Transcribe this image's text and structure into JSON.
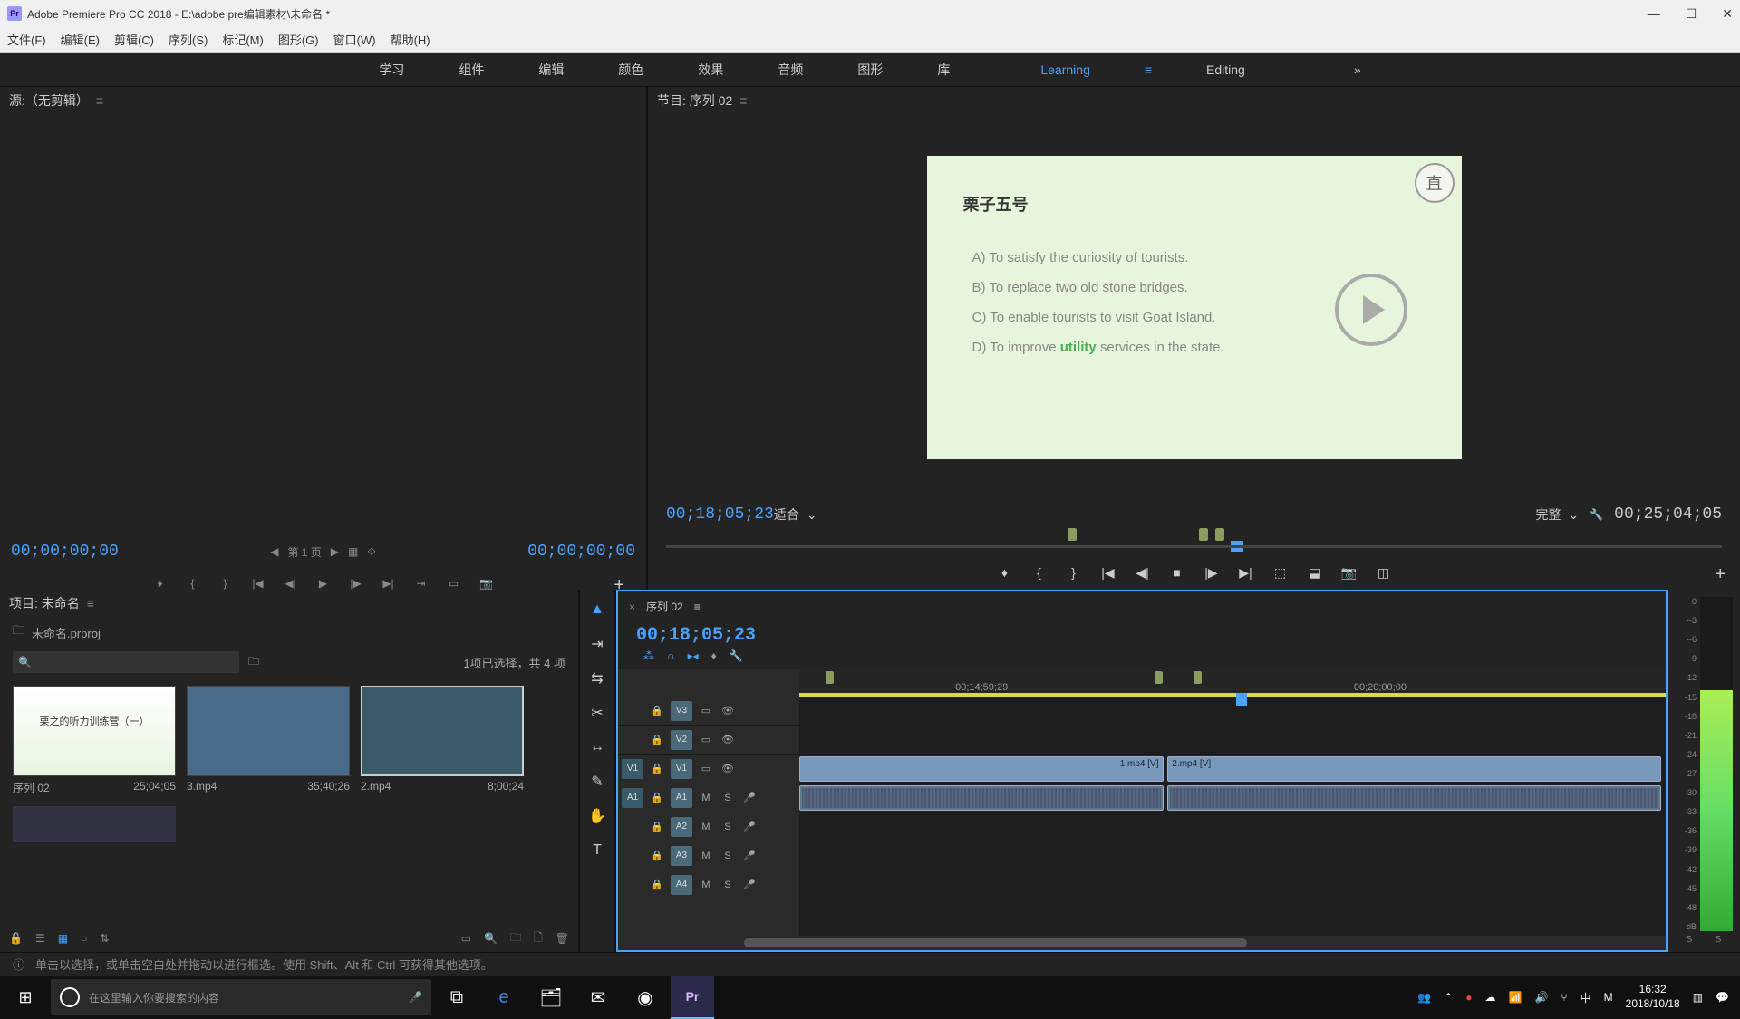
{
  "app": {
    "icon_label": "Pr",
    "title": "Adobe Premiere Pro CC 2018 - E:\\adobe pre编辑素材\\未命名 *"
  },
  "menubar": [
    "文件(F)",
    "编辑(E)",
    "剪辑(C)",
    "序列(S)",
    "标记(M)",
    "图形(G)",
    "窗口(W)",
    "帮助(H)"
  ],
  "workspaces": {
    "tabs": [
      "学习",
      "组件",
      "编辑",
      "颜色",
      "效果",
      "音频",
      "图形",
      "库"
    ],
    "learning": "Learning",
    "editing": "Editing"
  },
  "source_panel": {
    "title": "源:（无剪辑）",
    "timecode_left": "00;00;00;00",
    "page_nav": "第 1 页",
    "timecode_right": "00;00;00;00"
  },
  "program_panel": {
    "title": "节目: 序列 02",
    "timecode_left": "00;18;05;23",
    "fit_label": "适合",
    "quality_label": "完整",
    "timecode_right": "00;25;04;05",
    "video": {
      "heading": "栗子五号",
      "badge": "直",
      "opt_a": "A) To satisfy the curiosity of tourists.",
      "opt_b": "B) To replace two old stone bridges.",
      "opt_c": "C) To enable tourists to visit Goat Island.",
      "opt_d_pre": "D) To improve ",
      "opt_d_word": "utility",
      "opt_d_post": " services in the state."
    }
  },
  "project_panel": {
    "title": "项目: 未命名",
    "project_file": "未命名.prproj",
    "selection_info": "1项已选择，共 4 项",
    "bins": [
      {
        "name": "序列 02",
        "duration": "25;04;05",
        "thumb_text": "栗之的听力训练营（一）"
      },
      {
        "name": "3.mp4",
        "duration": "35;40;26",
        "thumb_text": ""
      },
      {
        "name": "2.mp4",
        "duration": "8;00;24",
        "thumb_text": ""
      }
    ]
  },
  "timeline": {
    "tab_title": "序列 02",
    "timecode": "00;18;05;23",
    "ruler_labels": [
      {
        "pos": 20,
        "text": "00;14;59;29"
      },
      {
        "pos": 65,
        "text": "00;20;00;00"
      }
    ],
    "video_tracks": [
      "V3",
      "V2",
      "V1"
    ],
    "audio_tracks": [
      "A1",
      "A2",
      "A3",
      "A4"
    ],
    "src_video": "V1",
    "src_audio": "A1",
    "clips": [
      {
        "name": "1.mp4 [V]",
        "track": "V1",
        "left": 0,
        "width": 42
      },
      {
        "name": "2.mp4 [V]",
        "track": "V1",
        "left": 42.5,
        "width": 57
      }
    ],
    "mute": "M",
    "solo": "S"
  },
  "audio_meter": {
    "scale": [
      "0",
      "--3",
      "--6",
      "--9",
      "-12",
      "-15",
      "-18",
      "-21",
      "-24",
      "-27",
      "-30",
      "-33",
      "-36",
      "-39",
      "-42",
      "-45",
      "-48",
      "dB"
    ],
    "footer": [
      "S",
      "S"
    ]
  },
  "status_bar": {
    "text": "单击以选择，或单击空白处并拖动以进行框选。使用 Shift、Alt 和 Ctrl 可获得其他选项。"
  },
  "taskbar": {
    "search_placeholder": "在这里输入你要搜索的内容",
    "time": "16:32",
    "date": "2018/10/18",
    "ime": "中"
  }
}
